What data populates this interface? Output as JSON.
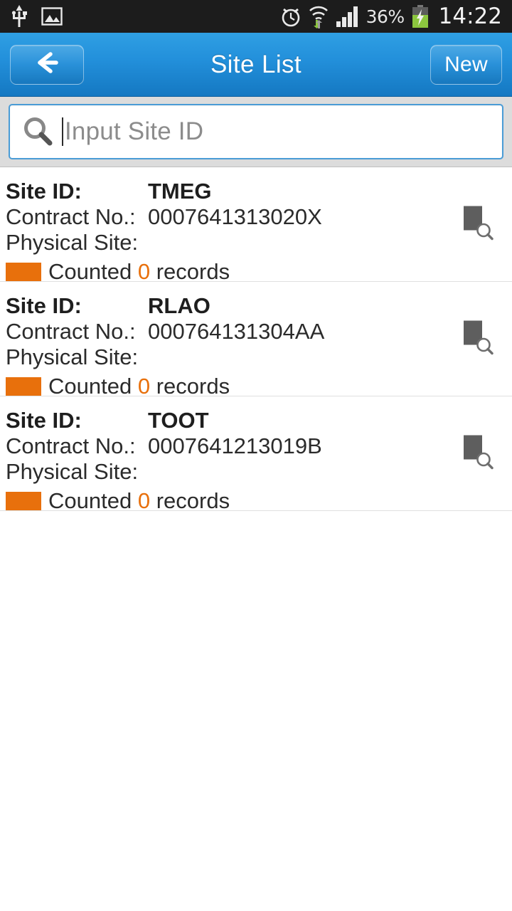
{
  "status_bar": {
    "left_icons": [
      "usb-icon",
      "gallery-image-icon"
    ],
    "right_icons": [
      "alarm-clock-icon",
      "wifi-transfer-icon",
      "signal-bars-icon",
      "battery-charging-icon"
    ],
    "battery_percent": "36%",
    "clock": "14:22",
    "background_color": "#1c1c1c"
  },
  "header": {
    "title": "Site List",
    "back_icon": "arrow-left-icon",
    "new_label": "New",
    "accent_color": "#2390db"
  },
  "search": {
    "icon": "search-icon",
    "placeholder": "Input Site ID",
    "value": "",
    "border_color": "#4a9cd6",
    "strip_color": "#dcdcdc"
  },
  "list": {
    "labels": {
      "site_id": "Site ID:",
      "contract_no": "Contract No.:",
      "physical_site": "Physical Site:"
    },
    "count_prefix": "Counted",
    "count_suffix": "records",
    "swatch_color": "#e8700c",
    "count_color": "#e8700c",
    "row_icon": "document-search-icon",
    "rows": [
      {
        "site_id": "TMEG",
        "contract_no": "0007641313020X",
        "physical_site": "",
        "count": "0"
      },
      {
        "site_id": "RLAO",
        "contract_no": "000764131304AA",
        "physical_site": "",
        "count": "0"
      },
      {
        "site_id": "TOOT",
        "contract_no": "0007641213019B",
        "physical_site": "",
        "count": "0"
      }
    ]
  }
}
